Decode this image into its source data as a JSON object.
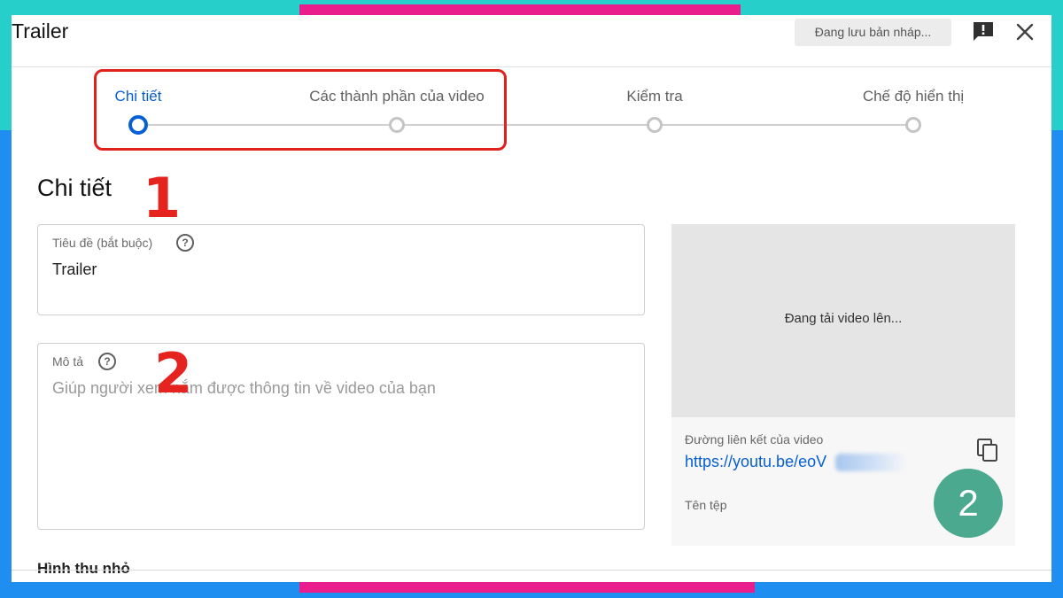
{
  "dialog": {
    "title": "Trailer",
    "draft_status": "Đang lưu bản nháp...",
    "feedback_icon": "feedback-icon",
    "close_icon": "close-icon"
  },
  "stepper": {
    "steps": [
      {
        "label": "Chi tiết",
        "active": true
      },
      {
        "label": "Các thành phần của video",
        "active": false
      },
      {
        "label": "Kiểm tra",
        "active": false
      },
      {
        "label": "Chế độ hiển thị",
        "active": false
      }
    ],
    "highlight_color": "#e1211c"
  },
  "details": {
    "heading": "Chi tiết",
    "title_field": {
      "label": "Tiêu đề (bắt buộc)",
      "value": "Trailer"
    },
    "description_field": {
      "label": "Mô tả",
      "placeholder": "Giúp người xem nắm được thông tin về video của bạn"
    },
    "thumbnail_heading": "Hình thu nhỏ"
  },
  "preview": {
    "status": "Đang tải video lên...",
    "link_label": "Đường liên kết của video",
    "link_value": "https://youtu.be/eoV",
    "filename_label": "Tên tệp",
    "copy_icon": "copy-icon"
  },
  "annotations": {
    "marker_1": "1",
    "marker_2": "2",
    "badge": "2",
    "marker_color": "#e52420",
    "badge_color": "#4ba990"
  },
  "colors": {
    "accent_blue": "#065fd4",
    "frame_teal": "#26cfc9",
    "frame_blue": "#1e8ff0",
    "frame_pink": "#e91e8c"
  }
}
